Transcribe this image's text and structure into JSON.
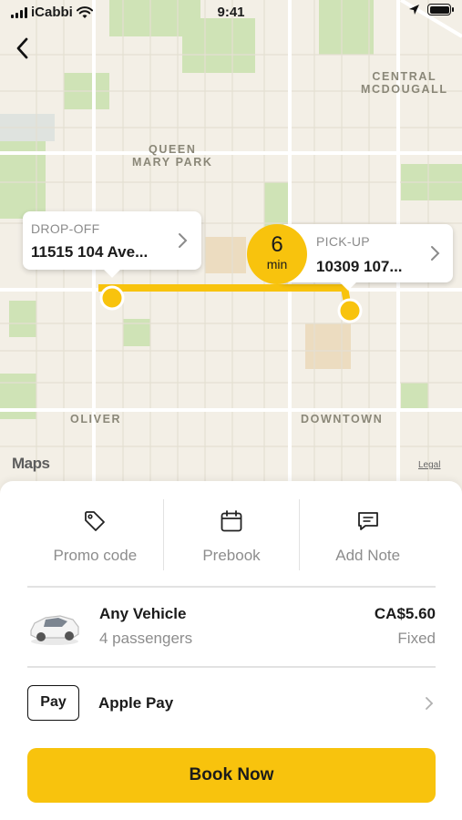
{
  "status_bar": {
    "carrier": "iCabbi",
    "time": "9:41"
  },
  "map": {
    "labels": {
      "central_mcdougall": "CENTRAL\nMCDOUGALL",
      "queen_mary_park": "QUEEN\nMARY PARK",
      "oliver": "OLIVER",
      "downtown": "DOWNTOWN"
    },
    "attribution": "Maps",
    "legal": "Legal"
  },
  "dropoff": {
    "caption": "DROP-OFF",
    "address": "11515 104 Ave..."
  },
  "pickup": {
    "caption": "PICK-UP",
    "address": "10309 107..."
  },
  "eta": {
    "value": "6",
    "unit": "min"
  },
  "actions": [
    {
      "label": "Promo code",
      "icon": "tag-icon"
    },
    {
      "label": "Prebook",
      "icon": "calendar-icon"
    },
    {
      "label": "Add Note",
      "icon": "note-icon"
    }
  ],
  "vehicle": {
    "name": "Any Vehicle",
    "passengers": "4 passengers",
    "price": "CA$5.60",
    "fare_type": "Fixed"
  },
  "payment": {
    "badge": "Pay",
    "method": "Apple Pay"
  },
  "book_button": "Book Now",
  "colors": {
    "accent": "#f8c30d",
    "map_bg": "#f3efe6",
    "park": "#cfe3b6"
  }
}
